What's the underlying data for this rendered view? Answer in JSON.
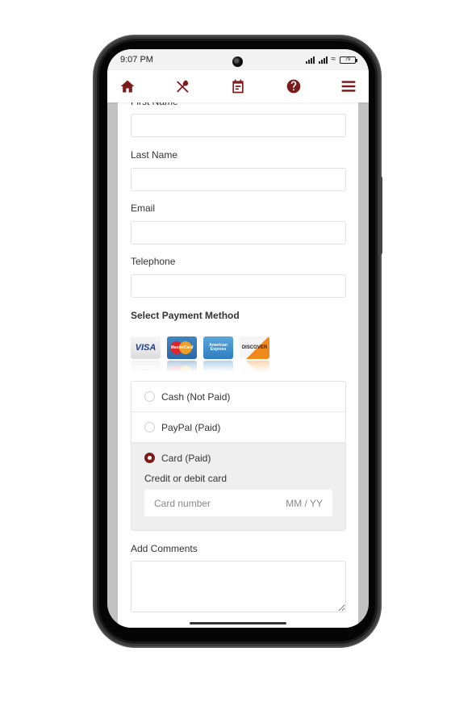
{
  "status_bar": {
    "time": "9:07 PM",
    "battery": "79"
  },
  "navbar": {
    "icons": [
      "home-icon",
      "utensils-icon",
      "calendar-icon",
      "help-icon",
      "menu-icon"
    ]
  },
  "form": {
    "first_name_label": "First Name",
    "last_name_label": "Last Name",
    "email_label": "Email",
    "telephone_label": "Telephone",
    "payment_label": "Select Payment Method",
    "card_logos": [
      "VISA",
      "MasterCard",
      "American Express",
      "DISCOVER"
    ],
    "payment_options": [
      {
        "label": "Cash (Not Paid)",
        "selected": false
      },
      {
        "label": "PayPal (Paid)",
        "selected": false
      },
      {
        "label": "Card (Paid)",
        "selected": true
      }
    ],
    "card_section_label": "Credit or debit card",
    "card_number_placeholder": "Card number",
    "expiry_placeholder": "MM / YY",
    "comments_label": "Add Comments"
  },
  "colors": {
    "accent": "#7a1c1c"
  }
}
